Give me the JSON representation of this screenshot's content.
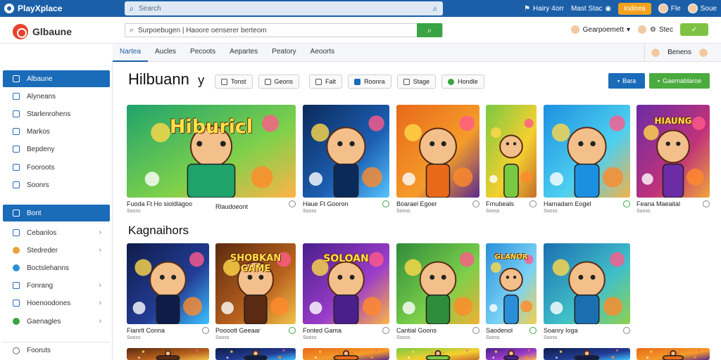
{
  "topbar": {
    "brand": "PlayXplace",
    "search_placeholder": "Search",
    "right": [
      "Hairy 4orr",
      "Mast Stac",
      "Indeea",
      "Fle",
      "Soue"
    ]
  },
  "header": {
    "logo": "Glbaune",
    "search_value": "Surpoebugen | Haoore oenserer berteom",
    "account_name": "Gearpoemett",
    "right_label": "Stec"
  },
  "nav": {
    "tabs": [
      "Nartea",
      "Aucles",
      "Pecoots",
      "Aepartes",
      "Peatory",
      "Aeoorts"
    ],
    "right_label": "Benens"
  },
  "sidebar": {
    "items": [
      {
        "label": "Albaune",
        "chevron": false
      },
      {
        "label": "Alyneans",
        "chevron": false
      },
      {
        "label": "Starlenrohens",
        "chevron": false
      },
      {
        "label": "Markos",
        "chevron": false
      },
      {
        "label": "Bepdeny",
        "chevron": false
      },
      {
        "label": "Fooroots",
        "chevron": false
      },
      {
        "label": "Soonrs",
        "chevron": false
      }
    ],
    "section_header": "Bont",
    "items2": [
      {
        "label": "Cebanlos",
        "chevron": true
      },
      {
        "label": "Stedreder",
        "chevron": true
      },
      {
        "label": "Boctslehanns",
        "chevron": false
      },
      {
        "label": "Fonrang",
        "chevron": true
      },
      {
        "label": "Hoenoodones",
        "chevron": true
      },
      {
        "label": "Gaenagles",
        "chevron": true
      }
    ],
    "footer": "Fooruts"
  },
  "main": {
    "title": "Hilbuann",
    "title_suffix": "y",
    "filters": [
      "Tonst",
      "Geons",
      "Falt",
      "Roonra",
      "Stage",
      "Hondle"
    ],
    "action_blue": "Bara",
    "action_green": "Gaernablaroe",
    "section2_title": "Kagnaihors"
  },
  "row1": [
    {
      "title": "Fuoda Ft Ho sioldlagoo",
      "sub": "Sooss",
      "art": "Hiburicl",
      "theme": "green"
    },
    {
      "title": "Rlaudoeont",
      "sub": "Sooss",
      "art": "",
      "theme": "blue"
    },
    {
      "title": "Haue Ft Gooron",
      "sub": "Sooss",
      "art": "",
      "theme": "blue2"
    },
    {
      "title": "Boarael Egoer",
      "sub": "Sooss",
      "art": "",
      "theme": "orange"
    },
    {
      "title": "Frnubeals",
      "sub": "Sooss",
      "art": "",
      "theme": "yellow"
    },
    {
      "title": "Harnadam Eogel",
      "sub": "Sooss",
      "art": "",
      "theme": "cyan"
    },
    {
      "title": "Feana Maeaital",
      "sub": "Sooss",
      "art": "HIAUNG",
      "theme": "purple"
    }
  ],
  "row2": [
    {
      "title": "Fianrlt Conna",
      "sub": "Sooss",
      "art": "",
      "theme": "navy"
    },
    {
      "title": "Poooott Geeaar",
      "sub": "Sooss",
      "art": "SHOBKAN GAME",
      "theme": "brown"
    },
    {
      "title": "Fonted Gama",
      "sub": "Sooss",
      "art": "SOLOAN",
      "theme": "violet"
    },
    {
      "title": "Cantial Goons",
      "sub": "Sooss",
      "art": "",
      "theme": "green2"
    },
    {
      "title": "Saodenol",
      "sub": "Sooss",
      "art": "GLANOR",
      "theme": "sky"
    },
    {
      "title": "Soanry Ioga",
      "sub": "Sooss",
      "art": "",
      "theme": "teal"
    }
  ]
}
